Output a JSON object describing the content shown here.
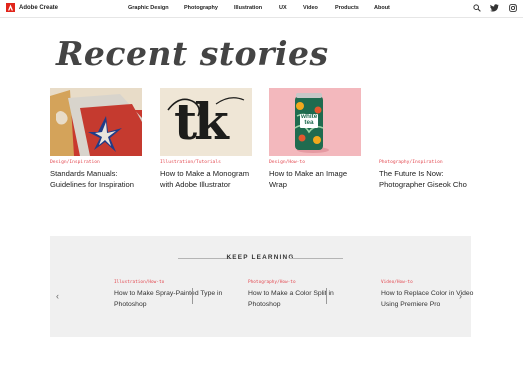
{
  "header": {
    "logo_text": "Adobe Create",
    "nav": [
      "Graphic Design",
      "Photography",
      "Illustration",
      "UX",
      "Video",
      "Products",
      "About"
    ],
    "icons": [
      "search-icon",
      "twitter-icon",
      "instagram-icon"
    ]
  },
  "page_title": "Recent stories",
  "stories": [
    {
      "tag": "Design/Inspiration",
      "title": "Standards Manuals: Guidelines for Inspiration"
    },
    {
      "tag": "Illustration/Tutorials",
      "title": "How to Make a Monogram with Adobe Illustrator"
    },
    {
      "tag": "Design/How-to",
      "title": "How to Make an Image Wrap"
    },
    {
      "tag": "Photography/Inspiration",
      "title": "The Future Is Now: Photographer Giseok Cho"
    }
  ],
  "keep_learning": {
    "heading": "KEEP LEARNING",
    "items": [
      {
        "tag": "Illustration/How-to",
        "title": "How to Make Spray-Painted Type in Photoshop"
      },
      {
        "tag": "Photography/How-to",
        "title": "How to Make a Color Split in Photoshop"
      },
      {
        "tag": "Video/How-to",
        "title": "How to Replace Color in Video Using Premiere Pro"
      }
    ]
  },
  "card_images": {
    "monogram_text": "tk",
    "can_text_line1": "white",
    "can_text_line2": "tea"
  },
  "colors": {
    "accent": "#e34850",
    "panel": "#f0f0f0"
  }
}
